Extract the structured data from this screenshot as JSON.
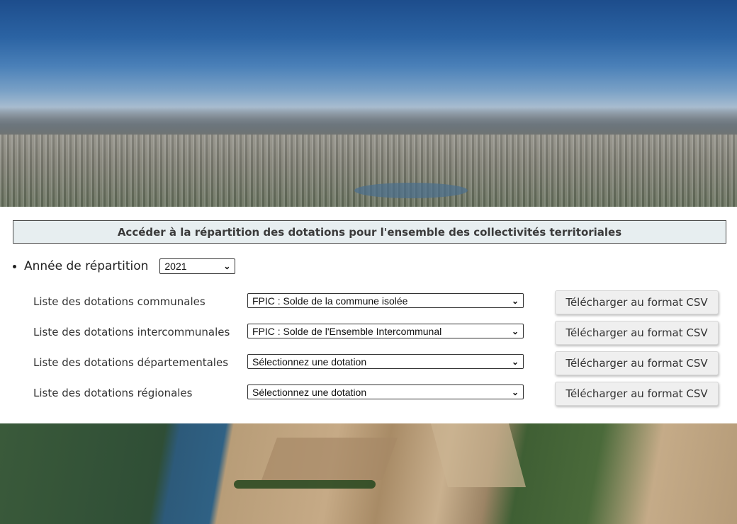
{
  "header": {
    "title": "Accéder à la répartition des dotations pour l'ensemble des collectivités territoriales"
  },
  "year": {
    "label": "Année de répartition",
    "selected": "2021"
  },
  "rows": [
    {
      "label": "Liste des dotations communales",
      "selected": "FPIC : Solde de la commune isolée",
      "button": "Télécharger au format CSV"
    },
    {
      "label": "Liste des dotations intercommunales",
      "selected": "FPIC : Solde de l'Ensemble Intercommunal",
      "button": "Télécharger au format CSV"
    },
    {
      "label": "Liste des dotations départementales",
      "selected": "Sélectionnez une dotation",
      "button": "Télécharger au format CSV"
    },
    {
      "label": "Liste des dotations régionales",
      "selected": "Sélectionnez une dotation",
      "button": "Télécharger au format CSV"
    }
  ],
  "icons": {
    "dropdown": "chevron-down-icon"
  }
}
